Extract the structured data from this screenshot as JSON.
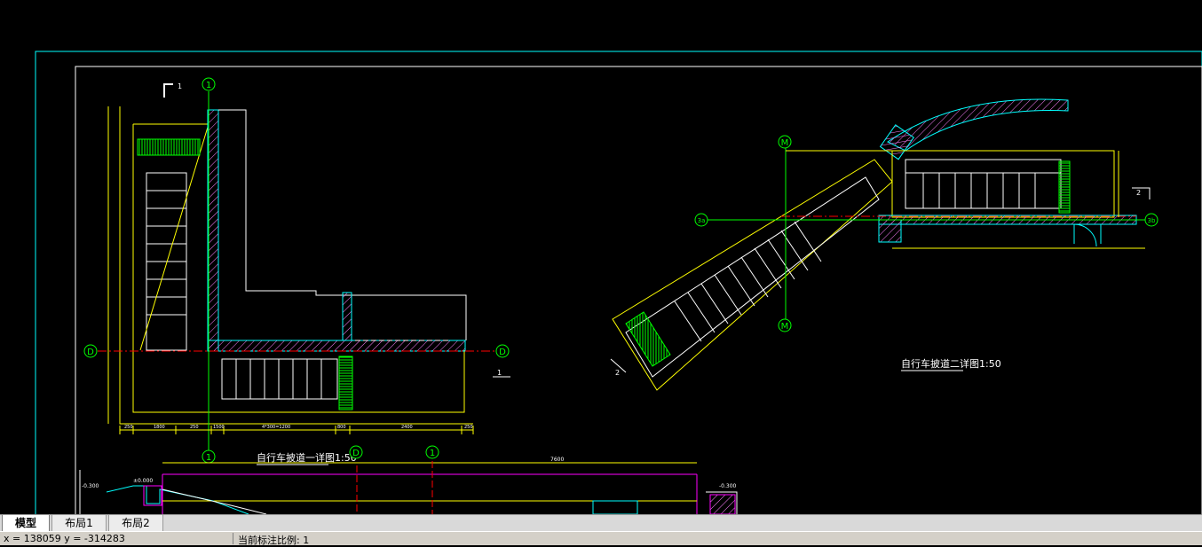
{
  "drawing": {
    "detail1_title": "自行车披道一详图1:50",
    "detail2_title": "自行车披道二详图1:50",
    "axis_labels": {
      "axis_1": "1",
      "axis_D": "D",
      "axis_M": "M",
      "axis_3a": "3a",
      "axis_3b": "3b"
    },
    "section_marks": {
      "sec_1": "1",
      "sec_2": "2"
    },
    "dimensions_bottom": [
      "250",
      "1800",
      "250",
      "1500",
      "4*300=1200",
      "800",
      "2400",
      "250"
    ],
    "dimensions_section": [
      "7600",
      "-0.300",
      "±0.000",
      "-0.300"
    ]
  },
  "tabs": [
    {
      "label": "模型",
      "active": true
    },
    {
      "label": "布局1",
      "active": false
    },
    {
      "label": "布局2",
      "active": false
    }
  ],
  "status": {
    "coords": "x = 138059  y = -314283",
    "scale_text": "当前标注比例: 1"
  },
  "colors": {
    "background": "#000000",
    "border": "#00ffff",
    "wall": "#00ffff",
    "dim": "#ffff00",
    "axis": "#00ff00",
    "hatch": "#00ff00",
    "center_line": "#ff0000",
    "section_line": "#ff00ff"
  }
}
